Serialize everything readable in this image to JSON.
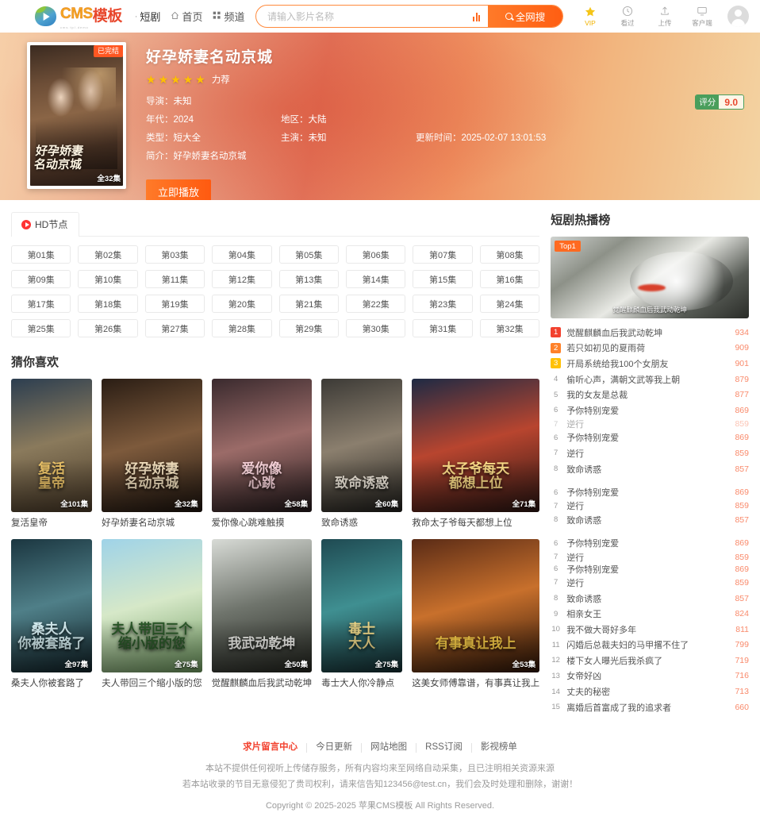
{
  "header": {
    "logo_cms": "CMS",
    "logo_mb": "模板",
    "logo_sub": "cms.tpl.demo",
    "nav": [
      {
        "label": "短剧",
        "icon": "dot-icon",
        "current": true
      },
      {
        "label": "首页",
        "icon": "home-icon",
        "current": false
      },
      {
        "label": "频道",
        "icon": "grid-icon",
        "current": false
      }
    ],
    "search": {
      "placeholder": "请输入影片名称",
      "value": "",
      "button_label": "全网搜",
      "rank_icon": "bar-chart-icon",
      "search_icon": "search-icon"
    },
    "tools": [
      {
        "label": "VIP",
        "icon": "star-vip-icon"
      },
      {
        "label": "看过",
        "icon": "clock-icon"
      },
      {
        "label": "上传",
        "icon": "upload-icon"
      },
      {
        "label": "客户端",
        "icon": "monitor-icon"
      }
    ],
    "avatar_icon": "user-avatar-icon"
  },
  "hero": {
    "title": "好孕娇妻名动京城",
    "poster_badge": "已完结",
    "poster_eps": "全32集",
    "poster_script": "好孕娇妻\n名动京城",
    "stars": 5,
    "rec_label": "力荐",
    "meta": [
      [
        {
          "key": "导演：",
          "value": "未知"
        }
      ],
      [
        {
          "key": "年代：",
          "value": "2024"
        },
        {
          "key": "地区：",
          "value": "大陆"
        }
      ],
      [
        {
          "key": "类型：",
          "value": "短大全"
        },
        {
          "key": "主演：",
          "value": "未知"
        },
        {
          "key": "更新时间：",
          "value": "2025-02-07 13:01:53"
        }
      ],
      [
        {
          "key": "简介：",
          "value": "好孕娇妻名动京城"
        }
      ]
    ],
    "play_label": "立即播放",
    "score_key": "评分",
    "score_value": "9.0"
  },
  "play": {
    "tab_label": "HD节点",
    "tab_icon": "play-circle-icon",
    "episodes": [
      "第01集",
      "第02集",
      "第03集",
      "第04集",
      "第05集",
      "第06集",
      "第07集",
      "第08集",
      "第09集",
      "第10集",
      "第11集",
      "第12集",
      "第13集",
      "第14集",
      "第15集",
      "第16集",
      "第17集",
      "第18集",
      "第19集",
      "第20集",
      "第21集",
      "第22集",
      "第23集",
      "第24集",
      "第25集",
      "第26集",
      "第27集",
      "第28集",
      "第29集",
      "第30集",
      "第31集",
      "第32集"
    ]
  },
  "recommend": {
    "title": "猜你喜欢",
    "cards": [
      {
        "name": "复活皇帝",
        "eps": "全101集",
        "art": "复活\n皇帝",
        "g1": "#2c3e50",
        "g2": "#8a7a5c",
        "g3": "#4a3a28",
        "art_color": "#f3c96b"
      },
      {
        "name": "好孕娇妻名动京城",
        "eps": "全32集",
        "art": "好孕娇妻\n名动京城",
        "g1": "#2a1d14",
        "g2": "#7d5a3c",
        "g3": "#1d140e",
        "art_color": "#f5e2c0"
      },
      {
        "name": "爱你像心跳难触摸",
        "eps": "全58集",
        "art": "爱你像\n心跳",
        "g1": "#3a2a2e",
        "g2": "#9b6b68",
        "g3": "#241a1c",
        "art_color": "#ffd9e0"
      },
      {
        "name": "致命诱惑",
        "eps": "全60集",
        "art": "致命诱惑",
        "g1": "#3c3a36",
        "g2": "#8b7f6e",
        "g3": "#201f1c",
        "art_color": "#f7efe2"
      },
      {
        "name": "救命太子爷每天都想上位",
        "eps": "全71集",
        "art": "太子爷每天\n都想上位",
        "g1": "#1e2a44",
        "g2": "#b8452f",
        "g3": "#2a1512",
        "art_color": "#ffe08a"
      },
      {
        "name": "桑夫人你被套路了",
        "eps": "全97集",
        "art": "桑夫人\n你被套路了",
        "g1": "#1b3640",
        "g2": "#4f7f88",
        "g3": "#112228",
        "art_color": "#d8f1f5"
      },
      {
        "name": "夫人带回三个缩小版的您",
        "eps": "全75集",
        "art": "夫人带回三个\n缩小版的您",
        "g1": "#9fd3e8",
        "g2": "#d6e8c8",
        "g3": "#6e9a5f",
        "art_color": "#2c5a2a"
      },
      {
        "name": "觉醒麒麟血后我武动乾坤",
        "eps": "全50集",
        "art": "我武动乾坤",
        "g1": "#d8dbd6",
        "g2": "#6f746c",
        "g3": "#23251f",
        "art_color": "#f2f2ee"
      },
      {
        "name": "毒士大人你冷静点",
        "eps": "全75集",
        "art": "毒士\n大人",
        "g1": "#1f4a52",
        "g2": "#3f8f91",
        "g3": "#142c30",
        "art_color": "#f0d98a"
      },
      {
        "name": "这美女师傅靠谱，有事真让我上",
        "eps": "全53集",
        "art": "有事真让我上",
        "g1": "#5a2b16",
        "g2": "#c8702c",
        "g3": "#2a1408",
        "art_color": "#ffd24a"
      }
    ]
  },
  "rank": {
    "title": "短剧热播榜",
    "top_badge": "Top1",
    "hero_caption": "觉醒麒麟血后我武动乾坤",
    "items": [
      {
        "no": "1",
        "name": "觉醒麒麟血后我武动乾坤",
        "hot": "934",
        "style": "top1"
      },
      {
        "no": "2",
        "name": "若只如初见的夏雨荷",
        "hot": "909",
        "style": "top2"
      },
      {
        "no": "3",
        "name": "开局系统给我100个女朋友",
        "hot": "901",
        "style": "top3"
      },
      {
        "no": "4",
        "name": "偷听心声，满朝文武等我上朝",
        "hot": "879",
        "style": ""
      },
      {
        "no": "5",
        "name": "我的女友是总裁",
        "hot": "877",
        "style": ""
      },
      {
        "no": "6",
        "name": "予你特别宠爱",
        "hot": "869",
        "style": ""
      },
      {
        "no": "7",
        "name": "逆行",
        "hot": "859",
        "style": "",
        "faded": true,
        "tight": true
      },
      {
        "no": "6",
        "name": "予你特别宠爱",
        "hot": "869",
        "style": ""
      },
      {
        "no": "7",
        "name": "逆行",
        "hot": "859",
        "style": ""
      },
      {
        "no": "8",
        "name": "致命诱惑",
        "hot": "857",
        "style": ""
      },
      {
        "no": "",
        "name": "",
        "hot": "",
        "style": "",
        "gap": true
      },
      {
        "no": "6",
        "name": "予你特别宠爱",
        "hot": "869",
        "style": ""
      },
      {
        "no": "7",
        "name": "逆行",
        "hot": "859",
        "style": "",
        "tight": true
      },
      {
        "no": "8",
        "name": "致命诱惑",
        "hot": "857",
        "style": ""
      },
      {
        "no": "",
        "name": "",
        "hot": "",
        "style": "",
        "gap": true
      },
      {
        "no": "6",
        "name": "予你特别宠爱",
        "hot": "869",
        "style": ""
      },
      {
        "no": "7",
        "name": "逆行",
        "hot": "859",
        "style": "",
        "tight": true
      },
      {
        "no": "6",
        "name": "予你特别宠爱",
        "hot": "869",
        "style": "",
        "tight": true
      },
      {
        "no": "7",
        "name": "逆行",
        "hot": "859",
        "style": ""
      },
      {
        "no": "8",
        "name": "致命诱惑",
        "hot": "857",
        "style": ""
      },
      {
        "no": "9",
        "name": "相亲女王",
        "hot": "824",
        "style": ""
      },
      {
        "no": "10",
        "name": "我不做大哥好多年",
        "hot": "811",
        "style": ""
      },
      {
        "no": "11",
        "name": "闪婚后总裁夫妇的马甲撂不住了",
        "hot": "799",
        "style": ""
      },
      {
        "no": "12",
        "name": "楼下女人曝光后我杀疯了",
        "hot": "719",
        "style": ""
      },
      {
        "no": "13",
        "name": "女帝好凶",
        "hot": "716",
        "style": ""
      },
      {
        "no": "14",
        "name": "丈夫的秘密",
        "hot": "713",
        "style": ""
      },
      {
        "no": "15",
        "name": "离婚后首富成了我的追求者",
        "hot": "660",
        "style": ""
      }
    ]
  },
  "footer": {
    "links": [
      {
        "label": "求片留言中心",
        "hot": true
      },
      {
        "label": "今日更新",
        "hot": false
      },
      {
        "label": "网站地图",
        "hot": false
      },
      {
        "label": "RSS订阅",
        "hot": false
      },
      {
        "label": "影视榜单",
        "hot": false
      }
    ],
    "line1": "本站不提供任何视听上传储存服务，所有内容均来至网络自动采集，且已注明相关资源来源",
    "line2": "若本站收录的节目无意侵犯了贵司权利，请来信告知123456@test.cn，我们会及时处理和删除，谢谢！",
    "copyright": "Copyright © 2025-2025 苹果CMS模板 All Rights Reserved."
  },
  "colors": {
    "accent": "#ff6a21",
    "hot": "#f98a6b",
    "rank1": "#f2412e",
    "score": "#4a9e5c"
  }
}
